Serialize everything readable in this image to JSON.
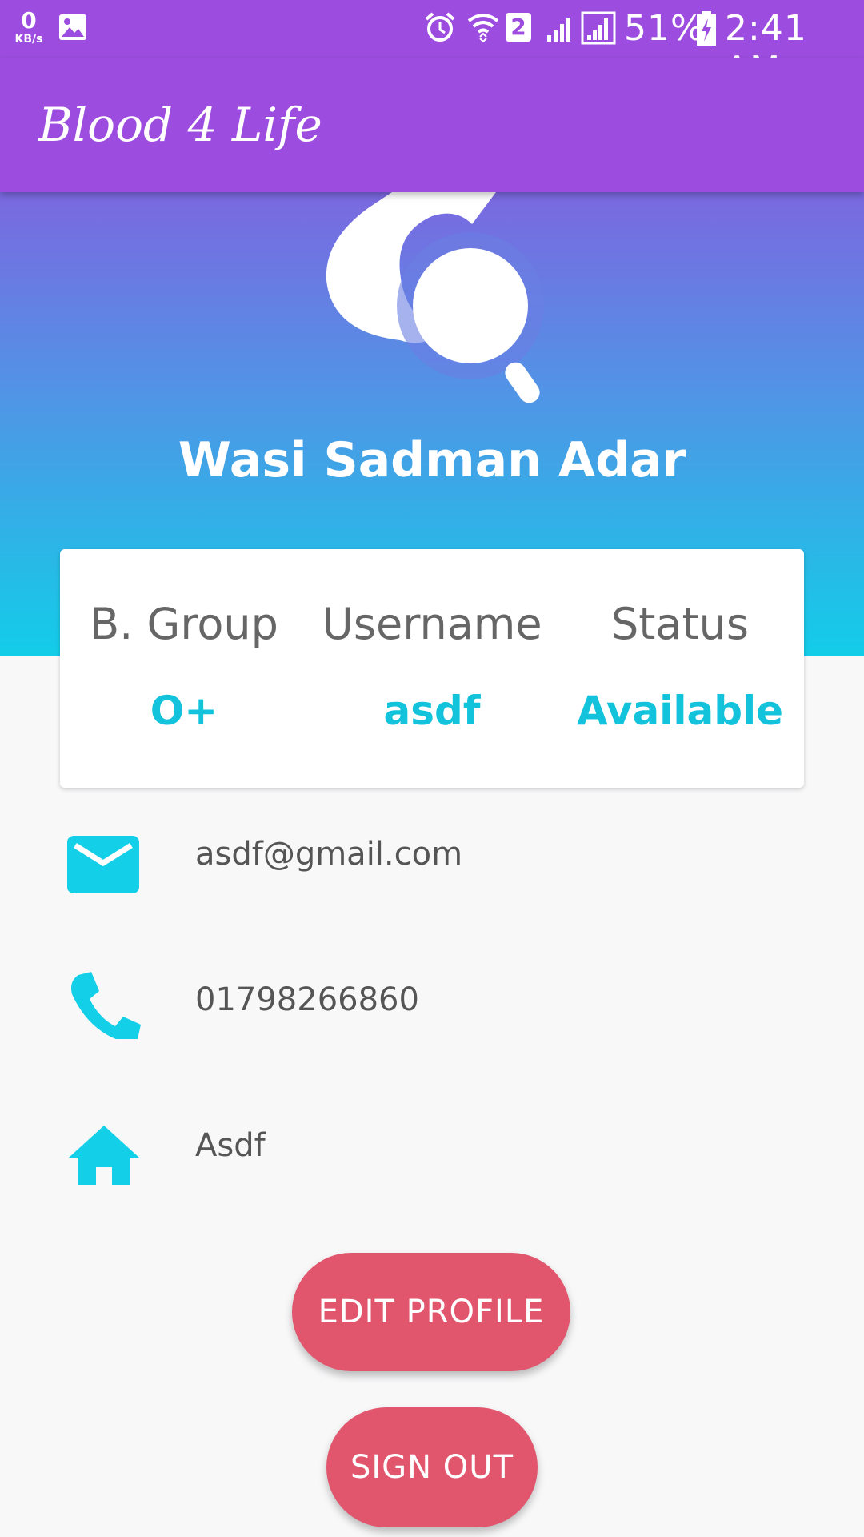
{
  "status_bar": {
    "kb_value": "0",
    "kb_unit": "KB/s",
    "sim_number": "2",
    "battery": "51%",
    "time": "2:41 AM",
    "icons": [
      "image-icon",
      "alarm-icon",
      "wifi-icon",
      "sim-badge-icon",
      "signal-icon",
      "signal-icon",
      "battery-charging-icon"
    ]
  },
  "app_bar": {
    "title": "Blood 4 Life"
  },
  "profile": {
    "name": "Wasi Sadman Adar",
    "logo_icon": "blood-drop-search-icon"
  },
  "info_card": {
    "columns": [
      {
        "label": "B. Group",
        "value": "O+"
      },
      {
        "label": "Username",
        "value": "asdf"
      },
      {
        "label": "Status",
        "value": "Available"
      }
    ]
  },
  "contacts": {
    "email": {
      "icon": "mail-icon",
      "value": "asdf@gmail.com"
    },
    "phone": {
      "icon": "phone-icon",
      "value": "01798266860"
    },
    "address": {
      "icon": "home-icon",
      "value": "Asdf"
    }
  },
  "buttons": {
    "edit_profile": "EDIT PROFILE",
    "sign_out": "SIGN OUT"
  },
  "colors": {
    "primary": "#9c4ddf",
    "accent": "#13c3dc",
    "button": "#e1556d",
    "gradient_top": "#7b68e0",
    "gradient_bottom": "#12cde8"
  }
}
